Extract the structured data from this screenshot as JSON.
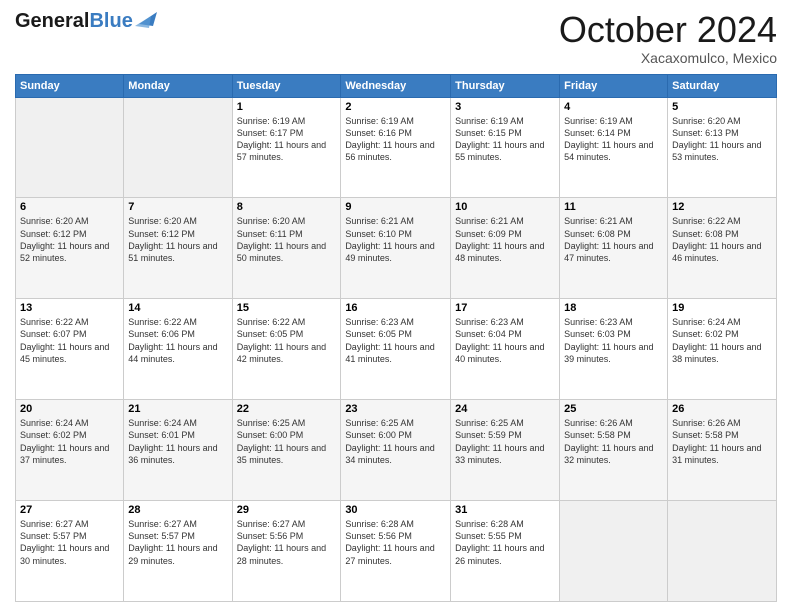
{
  "header": {
    "logo_line1": "General",
    "logo_line2": "Blue",
    "month": "October 2024",
    "location": "Xacaxomulco, Mexico"
  },
  "days_of_week": [
    "Sunday",
    "Monday",
    "Tuesday",
    "Wednesday",
    "Thursday",
    "Friday",
    "Saturday"
  ],
  "weeks": [
    [
      {
        "num": "",
        "info": "",
        "empty": true
      },
      {
        "num": "",
        "info": "",
        "empty": true
      },
      {
        "num": "1",
        "info": "Sunrise: 6:19 AM\nSunset: 6:17 PM\nDaylight: 11 hours and 57 minutes."
      },
      {
        "num": "2",
        "info": "Sunrise: 6:19 AM\nSunset: 6:16 PM\nDaylight: 11 hours and 56 minutes."
      },
      {
        "num": "3",
        "info": "Sunrise: 6:19 AM\nSunset: 6:15 PM\nDaylight: 11 hours and 55 minutes."
      },
      {
        "num": "4",
        "info": "Sunrise: 6:19 AM\nSunset: 6:14 PM\nDaylight: 11 hours and 54 minutes."
      },
      {
        "num": "5",
        "info": "Sunrise: 6:20 AM\nSunset: 6:13 PM\nDaylight: 11 hours and 53 minutes."
      }
    ],
    [
      {
        "num": "6",
        "info": "Sunrise: 6:20 AM\nSunset: 6:12 PM\nDaylight: 11 hours and 52 minutes."
      },
      {
        "num": "7",
        "info": "Sunrise: 6:20 AM\nSunset: 6:12 PM\nDaylight: 11 hours and 51 minutes."
      },
      {
        "num": "8",
        "info": "Sunrise: 6:20 AM\nSunset: 6:11 PM\nDaylight: 11 hours and 50 minutes."
      },
      {
        "num": "9",
        "info": "Sunrise: 6:21 AM\nSunset: 6:10 PM\nDaylight: 11 hours and 49 minutes."
      },
      {
        "num": "10",
        "info": "Sunrise: 6:21 AM\nSunset: 6:09 PM\nDaylight: 11 hours and 48 minutes."
      },
      {
        "num": "11",
        "info": "Sunrise: 6:21 AM\nSunset: 6:08 PM\nDaylight: 11 hours and 47 minutes."
      },
      {
        "num": "12",
        "info": "Sunrise: 6:22 AM\nSunset: 6:08 PM\nDaylight: 11 hours and 46 minutes."
      }
    ],
    [
      {
        "num": "13",
        "info": "Sunrise: 6:22 AM\nSunset: 6:07 PM\nDaylight: 11 hours and 45 minutes."
      },
      {
        "num": "14",
        "info": "Sunrise: 6:22 AM\nSunset: 6:06 PM\nDaylight: 11 hours and 44 minutes."
      },
      {
        "num": "15",
        "info": "Sunrise: 6:22 AM\nSunset: 6:05 PM\nDaylight: 11 hours and 42 minutes."
      },
      {
        "num": "16",
        "info": "Sunrise: 6:23 AM\nSunset: 6:05 PM\nDaylight: 11 hours and 41 minutes."
      },
      {
        "num": "17",
        "info": "Sunrise: 6:23 AM\nSunset: 6:04 PM\nDaylight: 11 hours and 40 minutes."
      },
      {
        "num": "18",
        "info": "Sunrise: 6:23 AM\nSunset: 6:03 PM\nDaylight: 11 hours and 39 minutes."
      },
      {
        "num": "19",
        "info": "Sunrise: 6:24 AM\nSunset: 6:02 PM\nDaylight: 11 hours and 38 minutes."
      }
    ],
    [
      {
        "num": "20",
        "info": "Sunrise: 6:24 AM\nSunset: 6:02 PM\nDaylight: 11 hours and 37 minutes."
      },
      {
        "num": "21",
        "info": "Sunrise: 6:24 AM\nSunset: 6:01 PM\nDaylight: 11 hours and 36 minutes."
      },
      {
        "num": "22",
        "info": "Sunrise: 6:25 AM\nSunset: 6:00 PM\nDaylight: 11 hours and 35 minutes."
      },
      {
        "num": "23",
        "info": "Sunrise: 6:25 AM\nSunset: 6:00 PM\nDaylight: 11 hours and 34 minutes."
      },
      {
        "num": "24",
        "info": "Sunrise: 6:25 AM\nSunset: 5:59 PM\nDaylight: 11 hours and 33 minutes."
      },
      {
        "num": "25",
        "info": "Sunrise: 6:26 AM\nSunset: 5:58 PM\nDaylight: 11 hours and 32 minutes."
      },
      {
        "num": "26",
        "info": "Sunrise: 6:26 AM\nSunset: 5:58 PM\nDaylight: 11 hours and 31 minutes."
      }
    ],
    [
      {
        "num": "27",
        "info": "Sunrise: 6:27 AM\nSunset: 5:57 PM\nDaylight: 11 hours and 30 minutes."
      },
      {
        "num": "28",
        "info": "Sunrise: 6:27 AM\nSunset: 5:57 PM\nDaylight: 11 hours and 29 minutes."
      },
      {
        "num": "29",
        "info": "Sunrise: 6:27 AM\nSunset: 5:56 PM\nDaylight: 11 hours and 28 minutes."
      },
      {
        "num": "30",
        "info": "Sunrise: 6:28 AM\nSunset: 5:56 PM\nDaylight: 11 hours and 27 minutes."
      },
      {
        "num": "31",
        "info": "Sunrise: 6:28 AM\nSunset: 5:55 PM\nDaylight: 11 hours and 26 minutes."
      },
      {
        "num": "",
        "info": "",
        "empty": true
      },
      {
        "num": "",
        "info": "",
        "empty": true
      }
    ]
  ]
}
